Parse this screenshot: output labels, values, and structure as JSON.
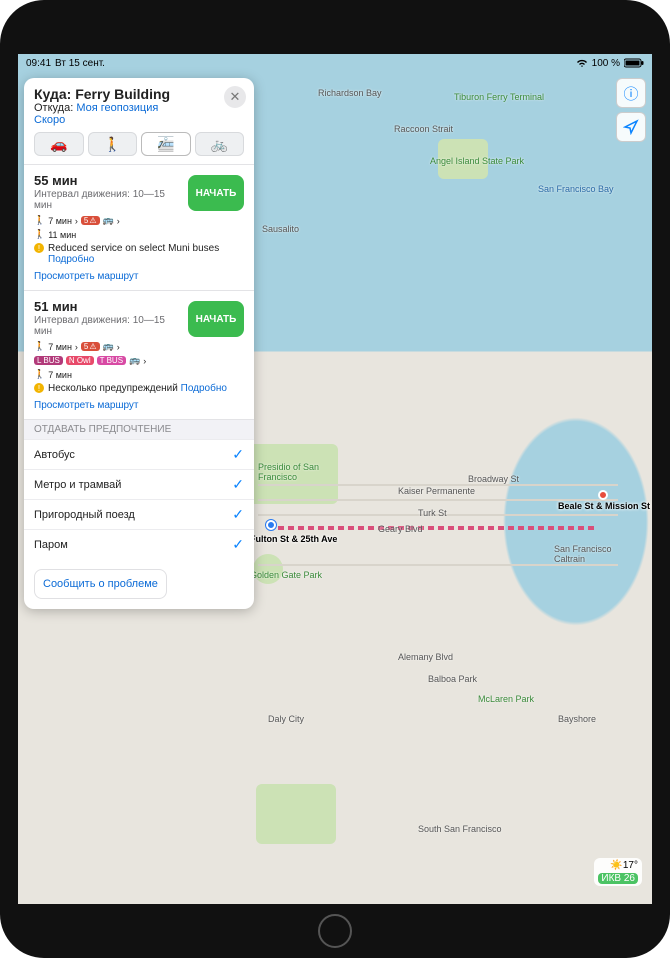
{
  "status": {
    "time": "09:41",
    "date": "Вт 15 сент.",
    "battery_pct": "100 %",
    "wifi": "wifi-icon",
    "battery_icon": "battery-icon"
  },
  "directions": {
    "dest_label": "Куда: Ferry Building",
    "from_prefix": "Откуда: ",
    "from_link": "Моя геопозиция",
    "soon_label": "Скоро",
    "modes": {
      "drive": "🚗",
      "walk": "🚶",
      "transit": "🚈",
      "bike": "🚲"
    }
  },
  "routes": [
    {
      "time": "55 мин",
      "interval": "Интервал движения: 10—15 мин",
      "walk1": "7 мин",
      "walk2": "11 мин",
      "line1": "5",
      "go": "НАЧАТЬ",
      "warning_text": "Reduced service on select Muni buses",
      "details_link": "Подробно",
      "preview": "Просмотреть маршрут"
    },
    {
      "time": "51 мин",
      "interval": "Интервал движения: 10—15 мин",
      "walk1": "7 мин",
      "walk3": "7 мин",
      "line1": "5",
      "lbus": "L BUS",
      "now": "N Owl",
      "tbus": "T BUS",
      "go": "НАЧАТЬ",
      "warning_text": "Несколько предупреждений",
      "details_link": "Подробно",
      "preview": "Просмотреть маршрут"
    }
  ],
  "prefs": {
    "header": "ОТДАВАТЬ ПРЕДПОЧТЕНИЕ",
    "items": [
      {
        "label": "Автобус",
        "checked": true
      },
      {
        "label": "Метро и трамвай",
        "checked": true
      },
      {
        "label": "Пригородный поезд",
        "checked": true
      },
      {
        "label": "Паром",
        "checked": true
      }
    ]
  },
  "report_label": "Сообщить о проблеме",
  "map": {
    "labels": {
      "richardson": "Richardson Bay",
      "tiburon": "Tiburon Ferry Terminal",
      "angel": "Angel Island State Park",
      "raccoon": "Raccoon Strait",
      "sausalito": "Sausalito",
      "sfbay": "San Francisco Bay",
      "presidio": "Presidio of San Francisco",
      "golden_gate": "Golden Gate Park",
      "south_sf": "South San Francisco",
      "kaiser": "Kaiser Permanente",
      "caltrain": "San Francisco Caltrain",
      "daly": "Daly City",
      "balboa": "Balboa Park",
      "mclaren": "McLaren Park",
      "bayshore": "Bayshore",
      "alemany": "Alemany Blvd",
      "broadway": "Broadway St",
      "turk": "Turk St",
      "geary": "Geary Blvd"
    },
    "stops": {
      "start": "Fulton St & 25th Ave",
      "end": "Beale St & Mission St"
    }
  },
  "weather": {
    "temp": "17°",
    "aqi": "ИКВ 26"
  }
}
